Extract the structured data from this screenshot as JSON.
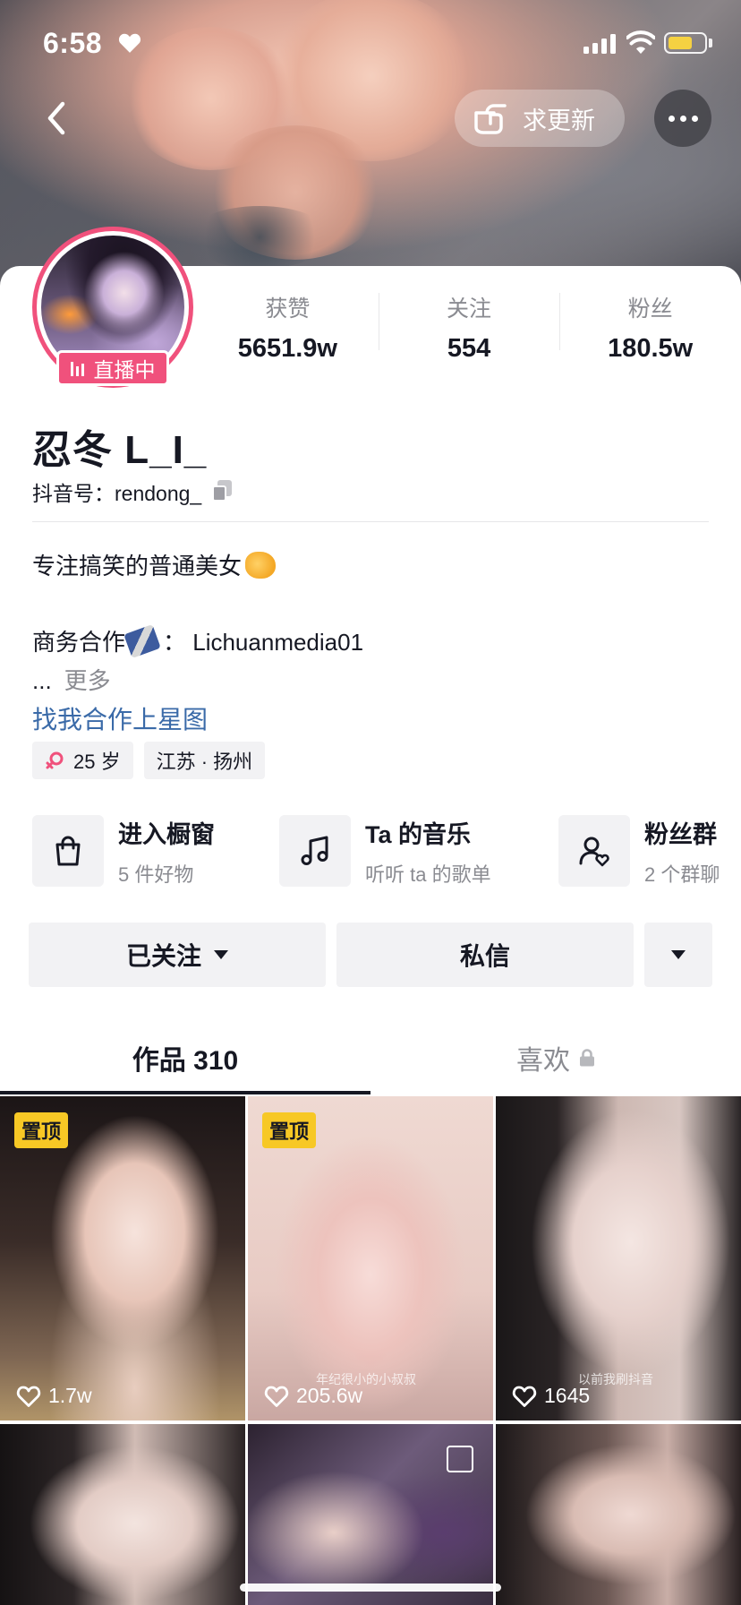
{
  "status_bar": {
    "time": "6:58"
  },
  "header": {
    "request_update_label": "求更新"
  },
  "profile": {
    "live_label": "直播中",
    "stats": [
      {
        "label": "获赞",
        "value": "5651.9w"
      },
      {
        "label": "关注",
        "value": "554"
      },
      {
        "label": "粉丝",
        "value": "180.5w"
      }
    ],
    "nickname": "忍冬 L_I_",
    "douyin_id": "抖音号：rendong_",
    "bio_line1": "专注搞笑的普通美女",
    "bio_line2_prefix": "商务合作",
    "bio_line2_suffix": "： Lichuanmedia01",
    "bio_ellipsis": "...",
    "bio_more": "更多",
    "star_link": "找我合作上星图",
    "tags": {
      "age": "25 岁",
      "location": "江苏 · 扬州"
    }
  },
  "entries": [
    {
      "title": "进入橱窗",
      "sub": "5 件好物",
      "icon": "shopping-bag-icon"
    },
    {
      "title": "Ta 的音乐",
      "sub": "听听 ta 的歌单",
      "icon": "music-note-icon"
    },
    {
      "title": "粉丝群",
      "sub": "2 个群聊",
      "icon": "fan-group-icon"
    }
  ],
  "actions": {
    "follow_label": "已关注",
    "message_label": "私信"
  },
  "tabs": {
    "works": "作品 310",
    "likes": "喜欢"
  },
  "videos": [
    {
      "pinned": "置顶",
      "likes": "1.7w",
      "caption": ""
    },
    {
      "pinned": "置顶",
      "likes": "205.6w",
      "caption": "年纪很小的小叔叔"
    },
    {
      "pinned": "",
      "likes": "1645",
      "caption": "以前我刷抖音"
    }
  ],
  "colors": {
    "accent_pink": "#f0517c",
    "pin_yellow": "#f7c825",
    "link_blue": "#3a6aa8"
  }
}
